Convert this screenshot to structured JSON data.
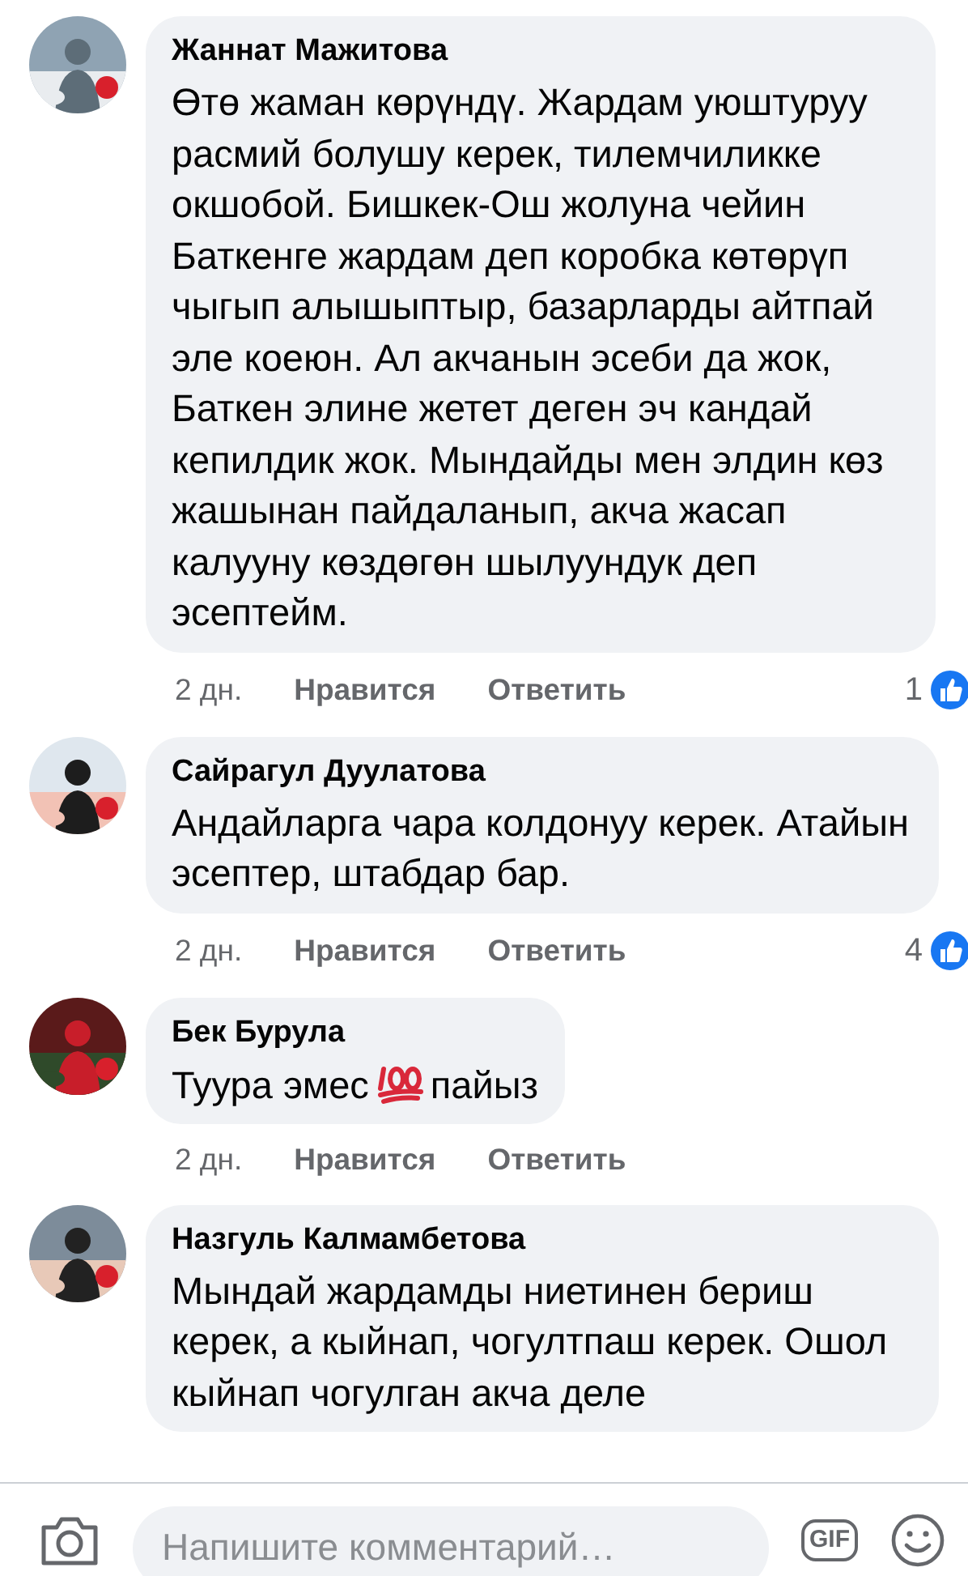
{
  "comments": [
    {
      "author": "Жаннат Мажитова",
      "text": "Өтө жаман көрүндү. Жардам уюштуруу расмий болушу керек, тилемчиликке окшобой.  Бишкек-Ош жолуна чейин Баткенге жардам деп коробка көтөрүп чыгып алышыптыр, базарларды айтпай эле коеюн.  Ал акчанын эсеби да жок, Баткен элине жетет деген эч кандай кепилдик жок. Мындайды мен элдин көз жашынан пайдаланып, акча жасап калууну көздөгөн шылуундук деп эсептейм.",
      "time": "2 дн.",
      "like": "Нравится",
      "reply": "Ответить",
      "reactions": "1"
    },
    {
      "author": "Сайрагул Дуулатова",
      "text": "Андайларга чара колдонуу керек. Атайын эсептер, штабдар бар.",
      "time": "2 дн.",
      "like": "Нравится",
      "reply": "Ответить",
      "reactions": "4"
    },
    {
      "author": "Бек Бурула",
      "segments": [
        {
          "kind": "text",
          "text": "Туура эмес"
        },
        {
          "kind": "hundred-emoji"
        },
        {
          "kind": "text",
          "text": "пайыз"
        }
      ],
      "time": "2 дн.",
      "like": "Нравится",
      "reply": "Ответить"
    },
    {
      "author": "Назгуль Калмамбетова",
      "text": "Мындай жардамды ниетинен бериш керек, а  кыйнап, чогултпаш керек. Ошол кыйнап чогулган акча деле"
    }
  ],
  "composer": {
    "placeholder": "Напишите комментарий…",
    "gif": "GIF"
  }
}
